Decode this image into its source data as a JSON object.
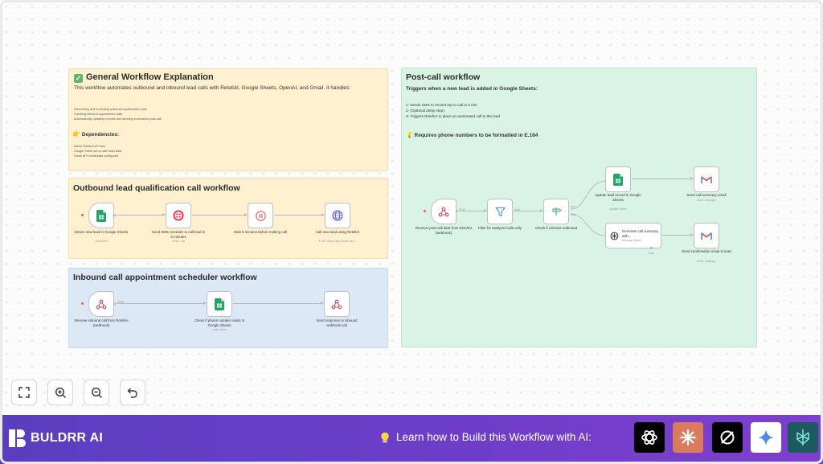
{
  "canvas": {
    "general_note": {
      "title": "General Workflow Explanation",
      "description": "This workflow automates outbound and inbound lead calls with RetellAI, Google Sheets, OpenAI, and Gmail. It handles:",
      "handles": [
        "Scheduling and reminding outbound qualification calls",
        "Handling inbound appointment calls",
        "Automatically updating records and sending summaries post-call"
      ],
      "dependencies_title": "Dependencies:",
      "dependencies": [
        "Active RetellAI API key",
        "Google Sheet set up with lead data",
        "Gmail API credentials configured"
      ]
    },
    "outbound_note": {
      "title": "Outbound lead qualification call workflow",
      "nodes": [
        {
          "label": "Detect new lead in Google Sheets",
          "sub": "rowAdded",
          "icon": "google-sheets-icon"
        },
        {
          "label": "Send SMS reminder to call lead in 5 minutes",
          "sub": "create: call",
          "icon": "twilio-icon"
        },
        {
          "label": "Wait 5 minutes before making call",
          "sub": "",
          "icon": "wait-icon"
        },
        {
          "label": "Call new lead using RetellAI",
          "sub": "POST: https://api.retellai.com...",
          "icon": "http-request-icon"
        }
      ]
    },
    "inbound_note": {
      "title": "Inbound call appointment scheduler workflow",
      "nodes": [
        {
          "label": "Receive inbound call from RetellAI (webhook)",
          "sub": "",
          "icon": "webhook-icon",
          "out_tag": "POST"
        },
        {
          "label": "Check if phone number exists in Google Sheets",
          "sub": "read: sheet",
          "icon": "google-sheets-icon"
        },
        {
          "label": "Send response to inbound webhook call",
          "sub": "",
          "icon": "webhook-icon"
        }
      ]
    },
    "postcall_note": {
      "title": "Post-call workflow",
      "trigger": "Triggers when a new lead is added in Google Sheets:",
      "steps": [
        "1- Sends SMS to remind rep to call in 5 min",
        "2- (Optional delay step)",
        "3- Triggers RetellAI to place an automated call to the lead"
      ],
      "requirement": "Requires phone numbers to be formatted in E.164",
      "nodes": [
        {
          "label": "Receive post-call data from RetellAI (webhook)",
          "sub": "",
          "icon": "webhook-icon",
          "out_tag": "POST"
        },
        {
          "label": "Filter for analyzed calls only",
          "sub": "",
          "icon": "filter-icon",
          "out_tag": "Kept"
        },
        {
          "label": "Check if call was outbound",
          "sub": "",
          "icon": "switch-icon",
          "out_tags": [
            "true",
            "false"
          ]
        },
        {
          "label": "Update lead record in Google Sheets",
          "sub": "update: sheet",
          "icon": "google-sheets-icon"
        },
        {
          "label": "Send call summary email",
          "sub": "send: message",
          "icon": "gmail-icon"
        },
        {
          "label": "Generate call summary with...",
          "sub": "Message Model",
          "icon": "openai-icon",
          "bottom_tag": "Tools"
        },
        {
          "label": "Send confirmation email to lead",
          "sub": "send: message",
          "icon": "gmail-icon"
        }
      ]
    }
  },
  "controls": [
    {
      "name": "fit-view-button",
      "icon": "expand-icon"
    },
    {
      "name": "zoom-in-button",
      "icon": "zoom-in-icon"
    },
    {
      "name": "zoom-out-button",
      "icon": "zoom-out-icon"
    },
    {
      "name": "undo-button",
      "icon": "undo-icon"
    }
  ],
  "footer": {
    "brand": "BULDRR AI",
    "learn_text": "Learn how to Build this Workflow with AI:",
    "ai_tools": [
      {
        "name": "chatgpt",
        "color": "#000000"
      },
      {
        "name": "claude",
        "color": "#da7a5e"
      },
      {
        "name": "perplexity",
        "color": "#000000"
      },
      {
        "name": "gemini",
        "color": "#ffffff"
      },
      {
        "name": "perplexity-alt",
        "color": "#1d5a5f"
      }
    ]
  }
}
